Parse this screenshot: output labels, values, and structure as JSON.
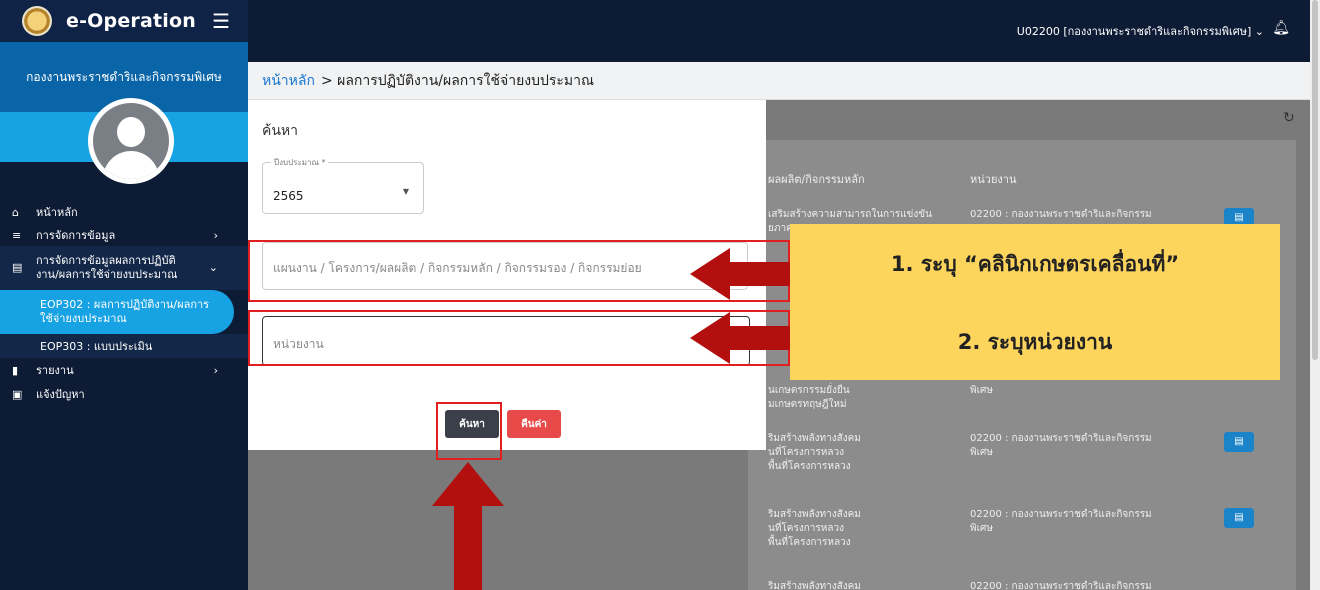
{
  "app": {
    "brand": "e-Operation",
    "org": "กองงานพระราชดำริและกิจกรรมพิเศษ",
    "user": "U02200 [กองงานพระราชดำริและกิจกรรมพิเศษ]"
  },
  "sidebar": {
    "items": [
      {
        "label": "หน้าหลัก"
      },
      {
        "label": "การจัดการข้อมูล"
      },
      {
        "label": "การจัดการข้อมูลผลการปฏิบัติงาน/ผลการใช้จ่ายงบประมาณ"
      },
      {
        "label": "EOP302 : ผลการปฏิบัติงาน/ผลการใช้จ่ายงบประมาณ"
      },
      {
        "label": "EOP303 : แบบประเมิน"
      },
      {
        "label": "รายงาน"
      },
      {
        "label": "แจ้งปัญหา"
      }
    ]
  },
  "breadcrumb": {
    "home": "หน้าหลัก",
    "current": "> ผลการปฏิบัติงาน/ผลการใช้จ่ายงบประมาณ"
  },
  "search_panel": {
    "title": "ค้นหา",
    "year_label": "ปีงบประมาณ *",
    "year_value": "2565",
    "plan_placeholder": "แผนงาน / โครงการ/ผลผลิต / กิจกรรมหลัก / กิจกรรมรอง / กิจกรรมย่อย",
    "unit_placeholder": "หน่วยงาน",
    "search_button": "ค้นหา",
    "reset_button": "คืนค่า"
  },
  "table": {
    "headers": [
      "ผลผลิต/กิจกรรมหลัก",
      "หน่วยงาน"
    ],
    "rows": [
      {
        "c1": "เสริมสร้างความสามารถในการแข่งขัน",
        "c1b": "ยภาค",
        "c2": "02200 : กองงานพระราชดำริและกิจกรรม"
      },
      {
        "c1": "นเกษตรกรรมยั่งยืน",
        "c1b": "มเกษตรทฤษฎีใหม่",
        "c2": "พิเศษ"
      },
      {
        "c1": "ริมสร้างพลังทางสังคม",
        "c1b": "นที่โครงการหลวง",
        "c1c": "พื้นที่โครงการหลวง",
        "c2": "02200 : กองงานพระราชดำริและกิจกรรม",
        "c2b": "พิเศษ"
      },
      {
        "c1": "ริมสร้างพลังทางสังคม",
        "c1b": "นที่โครงการหลวง",
        "c1c": "พื้นที่โครงการหลวง",
        "c2": "02200 : กองงานพระราชดำริและกิจกรรม",
        "c2b": "พิเศษ"
      },
      {
        "c1": "ริมสร้างพลังทางสังคม",
        "c2": "02200 : กองงานพระราชดำริและกิจกรรม"
      }
    ]
  },
  "annotations": {
    "note1": "1. ระบุ “คลินิกเกษตรเคลื่อนที่”",
    "note2": "2. ระบุหน่วยงาน"
  },
  "colors": {
    "sidebar": "#0d1b35",
    "accent": "#17a2e3",
    "note": "#fdd55d",
    "arrow": "#b30f0f"
  }
}
